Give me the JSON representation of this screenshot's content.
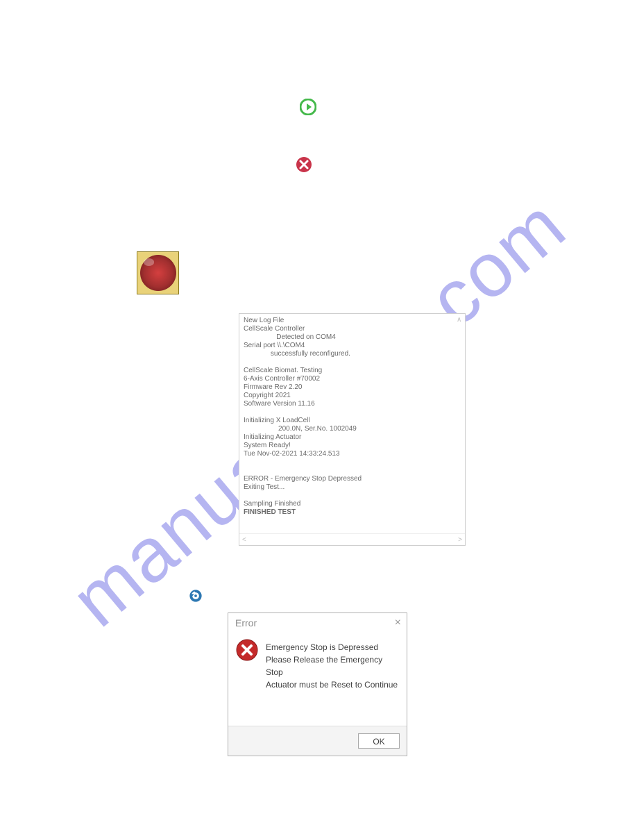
{
  "watermark": "manualshive.com",
  "icons": {
    "play": "play-circle-icon",
    "close": "close-circle-icon",
    "estop": "emergency-stop-button",
    "reset": "reset-reload-icon"
  },
  "log": {
    "lines": [
      "New Log File",
      "CellScale Controller",
      "                 Detected on COM4",
      "Serial port \\\\.\\COM4",
      "              successfully reconfigured.",
      "",
      "CellScale Biomat. Testing",
      "6-Axis Controller #70002",
      "Firmware Rev 2.20",
      "Copyright 2021",
      "Software Version 11.16",
      "",
      "Initializing X LoadCell",
      "                  200.0N, Ser.No. 1002049",
      "Initializing Actuator",
      "System Ready!",
      "Tue Nov-02-2021 14:33:24.513",
      "",
      "",
      "ERROR - Emergency Stop Depressed",
      "Exiting Test...",
      "",
      "Sampling Finished"
    ],
    "final_bold": "FINISHED TEST",
    "scroll_left": "<",
    "scroll_right": ">"
  },
  "dialog": {
    "title": "Error",
    "line1": "Emergency Stop is Depressed",
    "line2": "Please Release the Emergency Stop",
    "line3": "Actuator must be Reset to Continue",
    "ok_label": "OK"
  }
}
